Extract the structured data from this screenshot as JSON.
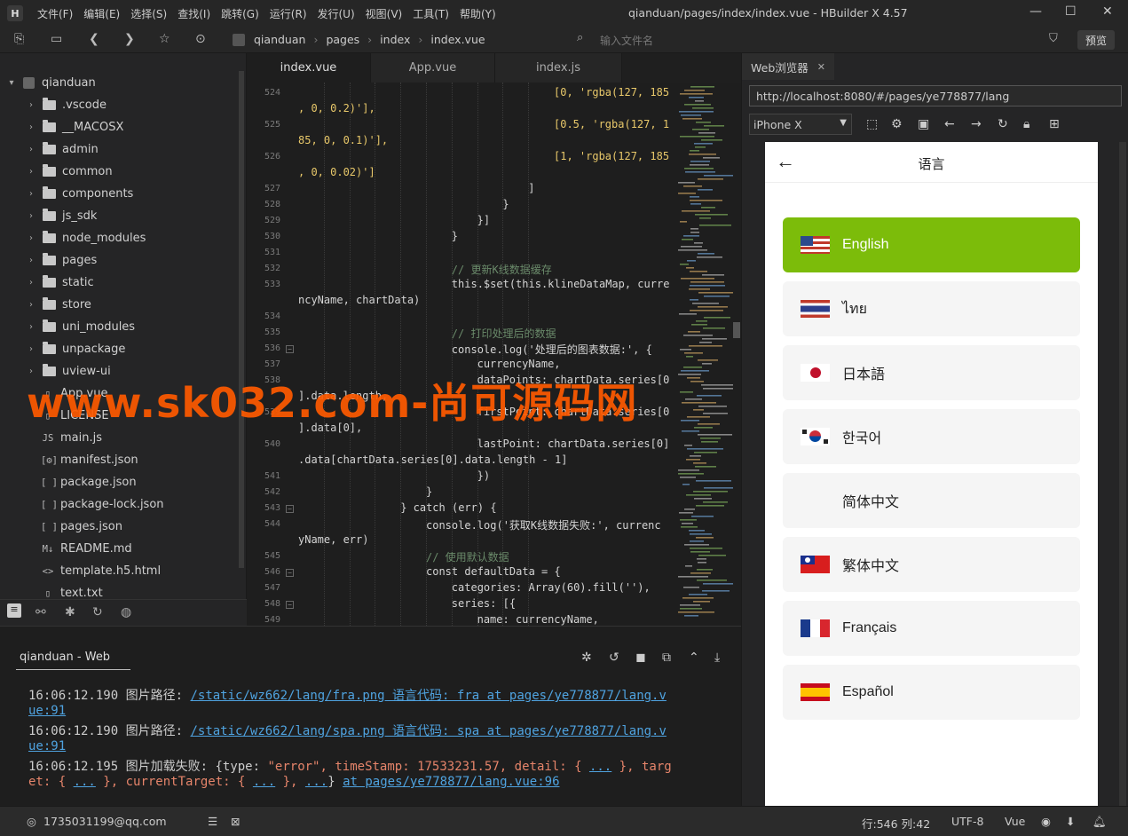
{
  "titlebar": {
    "logo": "H",
    "menu": [
      "文件(F)",
      "编辑(E)",
      "选择(S)",
      "查找(I)",
      "跳转(G)",
      "运行(R)",
      "发行(U)",
      "视图(V)",
      "工具(T)",
      "帮助(Y)"
    ],
    "window_title": "qianduan/pages/index/index.vue - HBuilder X 4.57"
  },
  "toolbar": {
    "breadcrumbs": [
      "qianduan",
      "pages",
      "index",
      "index.vue"
    ],
    "file_input_placeholder": "输入文件名",
    "preview_label": "预览"
  },
  "sidebar": {
    "project": "qianduan",
    "folders": [
      ".vscode",
      "__MACOSX",
      "admin",
      "common",
      "components",
      "js_sdk",
      "node_modules",
      "pages",
      "static",
      "store",
      "uni_modules",
      "unpackage",
      "uview-ui"
    ],
    "files": [
      {
        "icon": "file",
        "name": "App.vue"
      },
      {
        "icon": "file",
        "name": "LICENSE"
      },
      {
        "icon": "js",
        "name": "main.js"
      },
      {
        "icon": "gear",
        "name": "manifest.json"
      },
      {
        "icon": "json",
        "name": "package.json"
      },
      {
        "icon": "json",
        "name": "package-lock.json"
      },
      {
        "icon": "json",
        "name": "pages.json"
      },
      {
        "icon": "md",
        "name": "README.md"
      },
      {
        "icon": "html",
        "name": "template.h5.html"
      },
      {
        "icon": "file",
        "name": "text.txt"
      }
    ]
  },
  "editor": {
    "tabs": [
      "index.vue",
      "App.vue",
      "index.js"
    ],
    "lines": [
      {
        "n": "524",
        "ind": 40,
        "t": "[0, 'rgba(127, 185"
      },
      {
        "n": "",
        "ind": 0,
        "t": ", 0, 0.2)'],"
      },
      {
        "n": "525",
        "ind": 40,
        "t": "[0.5, 'rgba(127, 1"
      },
      {
        "n": "",
        "ind": 0,
        "t": "85, 0, 0.1)'],"
      },
      {
        "n": "526",
        "ind": 40,
        "t": "[1, 'rgba(127, 185"
      },
      {
        "n": "",
        "ind": 0,
        "t": ", 0, 0.02)']"
      },
      {
        "n": "527",
        "ind": 36,
        "t": "]"
      },
      {
        "n": "528",
        "ind": 32,
        "t": "}"
      },
      {
        "n": "529",
        "ind": 28,
        "t": "}]"
      },
      {
        "n": "530",
        "ind": 24,
        "t": "}"
      },
      {
        "n": "531",
        "ind": 0,
        "t": ""
      },
      {
        "n": "532",
        "ind": 24,
        "t": "// 更新K线数据缓存"
      },
      {
        "n": "533",
        "ind": 24,
        "t": "this.$set(this.klineDataMap, curre"
      },
      {
        "n": "",
        "ind": 0,
        "t": "ncyName, chartData)"
      },
      {
        "n": "534",
        "ind": 0,
        "t": ""
      },
      {
        "n": "535",
        "ind": 24,
        "t": "// 打印处理后的数据"
      },
      {
        "n": "536",
        "ind": 24,
        "t": "console.log('处理后的图表数据:', {"
      },
      {
        "n": "537",
        "ind": 28,
        "t": "currencyName,"
      },
      {
        "n": "538",
        "ind": 28,
        "t": "dataPoints: chartData.series[0"
      },
      {
        "n": "",
        "ind": 0,
        "t": "].data.length,"
      },
      {
        "n": "539",
        "ind": 28,
        "t": "firstPoint: chartData.series[0"
      },
      {
        "n": "",
        "ind": 0,
        "t": "].data[0],"
      },
      {
        "n": "540",
        "ind": 28,
        "t": "lastPoint: chartData.series[0]"
      },
      {
        "n": "",
        "ind": 0,
        "t": ".data[chartData.series[0].data.length - 1]"
      },
      {
        "n": "541",
        "ind": 28,
        "t": "})"
      },
      {
        "n": "542",
        "ind": 20,
        "t": "}"
      },
      {
        "n": "543",
        "ind": 16,
        "t": "} catch (err) {"
      },
      {
        "n": "544",
        "ind": 20,
        "t": "console.log('获取K线数据失败:', currenc"
      },
      {
        "n": "",
        "ind": 0,
        "t": "yName, err)"
      },
      {
        "n": "545",
        "ind": 20,
        "t": "// 使用默认数据"
      },
      {
        "n": "546",
        "ind": 20,
        "t": "const defaultData = {"
      },
      {
        "n": "547",
        "ind": 24,
        "t": "categories: Array(60).fill(''),"
      },
      {
        "n": "548",
        "ind": 24,
        "t": "series: [{"
      },
      {
        "n": "549",
        "ind": 28,
        "t": "name: currencyName,"
      }
    ]
  },
  "browser": {
    "tab_label": "Web浏览器",
    "url": "http://localhost:8080/#/pages/ye778877/lang",
    "device": "iPhone X",
    "page_title": "语言",
    "languages": [
      {
        "name": "English",
        "flag": "us",
        "selected": true
      },
      {
        "name": "ไทย",
        "flag": "th",
        "selected": false
      },
      {
        "name": "日本語",
        "flag": "jp",
        "selected": false
      },
      {
        "name": "한국어",
        "flag": "kr",
        "selected": false
      },
      {
        "name": "简体中文",
        "flag": "none",
        "selected": false
      },
      {
        "name": "繁体中文",
        "flag": "tw",
        "selected": false
      },
      {
        "name": "Français",
        "flag": "fr",
        "selected": false
      },
      {
        "name": "Español",
        "flag": "es",
        "selected": false
      }
    ],
    "accent_color": "#7cbc0a"
  },
  "console": {
    "tab_label": "qianduan - Web",
    "log1_time": "16:06:12.190",
    "log1_label": "图片路径:",
    "log1_link_a": "/static/wz662/lang/fra.png 语言代码: fra at pages/ye778877/lang.v",
    "log1_link_b": "ue:91",
    "log2_time": "16:06:12.190",
    "log2_label": "图片路径:",
    "log2_link_a": "/static/wz662/lang/spa.png 语言代码: spa at pages/ye778877/lang.v",
    "log2_link_b": "ue:91",
    "log3_time": "16:06:12.195",
    "log3_label": "图片加载失败:",
    "log3_a": "{type: ",
    "log3_b": "\"error\"",
    "log3_c": ", timeStamp: ",
    "log3_d": "17533231.57",
    "log3_e": ", detail: { ",
    "log3_f": "...",
    "log3_g": " }, targ",
    "log3_h": "et: { ",
    "log3_i": "...",
    "log3_j": " }, currentTarget: { ",
    "log3_k": "...",
    "log3_l": " }, ",
    "log3_m": "...",
    "log3_n": "} ",
    "log3_o": "at pages/ye778877/lang.vue:96"
  },
  "status": {
    "user": "1735031199@qq.com",
    "position": "行:546  列:42",
    "encoding": "UTF-8",
    "language": "Vue"
  },
  "watermark": "www.sk032.com-尚可源码网"
}
